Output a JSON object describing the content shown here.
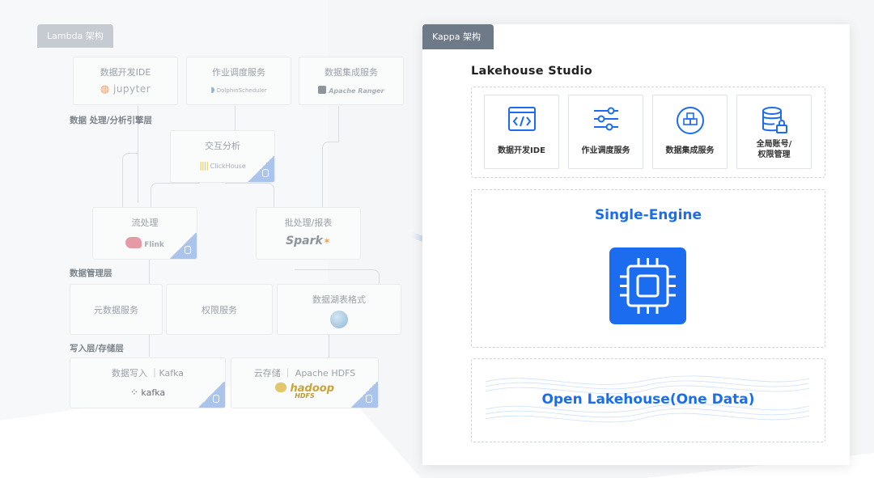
{
  "lambda": {
    "tag": "Lambda 架构",
    "top_tools": [
      {
        "title": "数据开发IDE",
        "logo": "Jupyter",
        "logo_text": "jupyter"
      },
      {
        "title": "作业调度服务",
        "logo": "DolphinScheduler",
        "logo_text": "DolphinScheduler"
      },
      {
        "title": "数据集成服务",
        "logo": "Apache Ranger",
        "logo_text": "Apache Ranger"
      }
    ],
    "layer_engine": "数据 处理/分析引擎层",
    "interactive": {
      "title": "交互分析",
      "logo_text": "ClickHouse"
    },
    "stream": {
      "title": "流处理",
      "logo_text": "Flink"
    },
    "batch": {
      "title": "批处理/报表",
      "logo_text": "Spark"
    },
    "layer_mgmt": "数据管理层",
    "mgmt": [
      {
        "title": "元数据服务"
      },
      {
        "title": "权限服务"
      },
      {
        "title": "数据湖表格式"
      }
    ],
    "layer_write": "写入层/存储层",
    "write": {
      "title": "数据写入 ｜Kafka",
      "logo_text": "kafka"
    },
    "storage": {
      "title": "云存储 ｜ Apache HDFS",
      "logo_text": "hadoop",
      "logo_sub": "HDFS"
    }
  },
  "kappa": {
    "tag": "Kappa 架构",
    "studio_title": "Lakehouse  Studio",
    "studio_items": [
      {
        "icon": "code-window-icon",
        "label_1": "数据开发IDE",
        "label_2": ""
      },
      {
        "icon": "sliders-icon",
        "label_1": "作业调度服务",
        "label_2": ""
      },
      {
        "icon": "cubes-icon",
        "label_1": "数据集成服务",
        "label_2": ""
      },
      {
        "icon": "database-lock-icon",
        "label_1": "全局账号/",
        "label_2": "权限管理"
      }
    ],
    "engine_title": "Single-Engine",
    "engine_icon": "cpu-chip-icon",
    "lake_title": "Open Lakehouse(One Data)"
  },
  "colors": {
    "accent": "#1c6cf0",
    "kappa_tag": "#6e7a88",
    "lambda_tag": "#c6cbd1",
    "corner_badge": "#aac4ec"
  }
}
